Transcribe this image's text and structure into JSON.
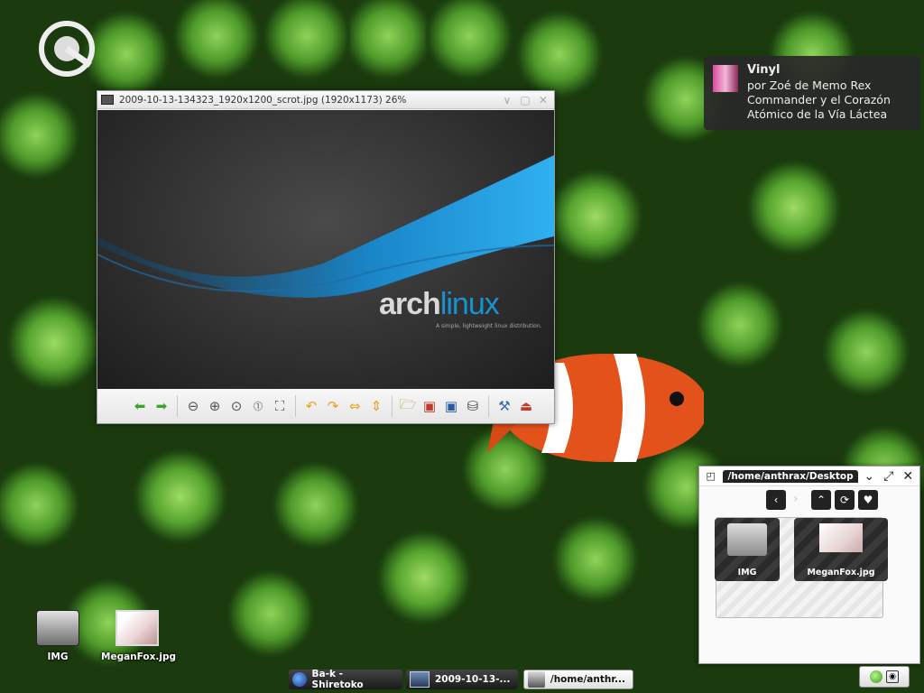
{
  "notification": {
    "title": "Vinyl",
    "body_line1": "por Zoé de Memo Rex",
    "body_line2": "Commander y el Corazón",
    "body_line3": "Atómico de la Vía Láctea"
  },
  "viewer": {
    "title": "2009-10-13-134323_1920x1200_scrot.jpg (1920x1173) 26%",
    "image_logo_left": "arch",
    "image_logo_right": "linux",
    "image_tagline": "A simple, lightweight linux distribution."
  },
  "filebrowser": {
    "path": "/home/anthrax/Desktop",
    "items": [
      {
        "label": "IMG"
      },
      {
        "label": "MeganFox.jpg"
      }
    ]
  },
  "desktop_icons": [
    {
      "label": "IMG"
    },
    {
      "label": "MeganFox.jpg"
    }
  ],
  "taskbar": {
    "tasks": [
      {
        "label": "Ba-k - Shiretoko"
      },
      {
        "label": "2009-10-13-..."
      },
      {
        "label": "/home/anthr..."
      }
    ]
  },
  "colors": {
    "arch_blue": "#1793d1",
    "wallpaper_green": "#4f9a2a"
  }
}
